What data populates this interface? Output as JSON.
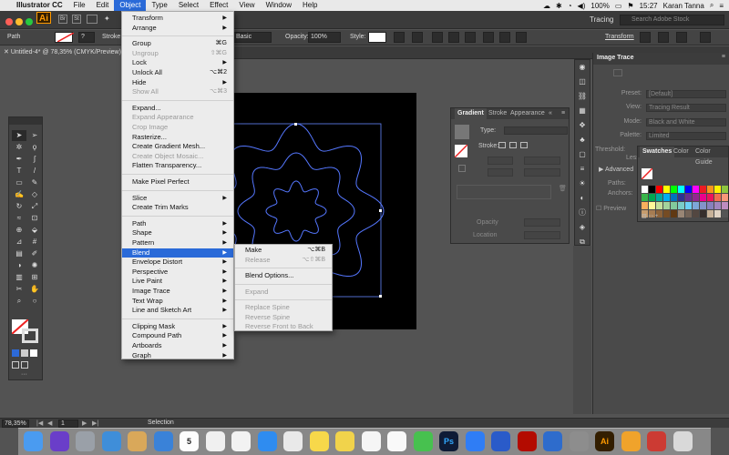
{
  "menubar": {
    "app_name": "Illustrator CC",
    "items": [
      "File",
      "Edit",
      "Object",
      "Type",
      "Select",
      "Effect",
      "View",
      "Window",
      "Help"
    ],
    "active_item": "Object",
    "battery": "100%",
    "time": "15:27",
    "user": "Karan Tanna"
  },
  "appbar": {
    "logo": "Ai",
    "workspace_label": "Tracing",
    "search_placeholder": "Search Adobe Stock"
  },
  "controlbar": {
    "object_type": "Path",
    "stroke_label": "Stroke",
    "brush": "Basic",
    "opacity_label": "Opacity:",
    "opacity_value": "100%",
    "style_label": "Style:",
    "transform_label": "Transform"
  },
  "document": {
    "tab_title": "Untitled-4* @ 78,35% (CMYK/Preview)"
  },
  "object_menu": {
    "items": [
      {
        "label": "Transform",
        "submenu": true
      },
      {
        "label": "Arrange",
        "submenu": true
      },
      {
        "sep": true
      },
      {
        "label": "Group",
        "shortcut": "⌘G"
      },
      {
        "label": "Ungroup",
        "shortcut": "⇧⌘G",
        "disabled": true
      },
      {
        "label": "Lock",
        "submenu": true
      },
      {
        "label": "Unlock All",
        "shortcut": "⌥⌘2"
      },
      {
        "label": "Hide",
        "submenu": true
      },
      {
        "label": "Show All",
        "shortcut": "⌥⌘3",
        "disabled": true
      },
      {
        "sep": true
      },
      {
        "label": "Expand..."
      },
      {
        "label": "Expand Appearance",
        "disabled": true
      },
      {
        "label": "Crop Image",
        "disabled": true
      },
      {
        "label": "Rasterize..."
      },
      {
        "label": "Create Gradient Mesh..."
      },
      {
        "label": "Create Object Mosaic...",
        "disabled": true
      },
      {
        "label": "Flatten Transparency..."
      },
      {
        "sep": true
      },
      {
        "label": "Make Pixel Perfect"
      },
      {
        "sep": true
      },
      {
        "label": "Slice",
        "submenu": true
      },
      {
        "label": "Create Trim Marks"
      },
      {
        "sep": true
      },
      {
        "label": "Path",
        "submenu": true
      },
      {
        "label": "Shape",
        "submenu": true
      },
      {
        "label": "Pattern",
        "submenu": true
      },
      {
        "label": "Blend",
        "submenu": true,
        "highlight": true
      },
      {
        "label": "Envelope Distort",
        "submenu": true
      },
      {
        "label": "Perspective",
        "submenu": true
      },
      {
        "label": "Live Paint",
        "submenu": true
      },
      {
        "label": "Image Trace",
        "submenu": true
      },
      {
        "label": "Text Wrap",
        "submenu": true
      },
      {
        "label": "Line and Sketch Art",
        "submenu": true
      },
      {
        "sep": true
      },
      {
        "label": "Clipping Mask",
        "submenu": true
      },
      {
        "label": "Compound Path",
        "submenu": true
      },
      {
        "label": "Artboards",
        "submenu": true
      },
      {
        "label": "Graph",
        "submenu": true
      }
    ]
  },
  "blend_submenu": {
    "items": [
      {
        "label": "Make",
        "shortcut": "⌥⌘B"
      },
      {
        "label": "Release",
        "shortcut": "⌥⇧⌘B",
        "disabled": true
      },
      {
        "sep": true
      },
      {
        "label": "Blend Options..."
      },
      {
        "sep": true
      },
      {
        "label": "Expand",
        "disabled": true
      },
      {
        "sep": true
      },
      {
        "label": "Replace Spine",
        "disabled": true
      },
      {
        "label": "Reverse Spine",
        "disabled": true
      },
      {
        "label": "Reverse Front to Back",
        "disabled": true
      }
    ]
  },
  "gradient_panel": {
    "tabs": [
      "Gradient",
      "Stroke",
      "Appearance"
    ],
    "type_label": "Type:",
    "stroke_label": "Stroke:",
    "opacity_label": "Opacity",
    "location_label": "Location"
  },
  "image_trace_panel": {
    "title": "Image Trace",
    "rows": [
      {
        "key": "Preset:",
        "value": "[Default]"
      },
      {
        "key": "View:",
        "value": "Tracing Result"
      },
      {
        "key": "Mode:",
        "value": "Black and White"
      },
      {
        "key": "Palette:",
        "value": "Limited"
      },
      {
        "key": "Threshold:",
        "value": ""
      }
    ],
    "less_label": "Less",
    "advanced_label": "Advanced",
    "paths_label": "Paths:",
    "anchors_label": "Anchors:",
    "preview_label": "Preview"
  },
  "swatches_panel": {
    "tabs": [
      "Swatches",
      "Color",
      "Color Guide"
    ],
    "colors": [
      "#ffffff",
      "#000000",
      "#ff0000",
      "#ffff00",
      "#00ff00",
      "#00ffff",
      "#0000ff",
      "#ff00ff",
      "#ed1c24",
      "#f7941d",
      "#fff200",
      "#8dc63f",
      "#39b54a",
      "#00a651",
      "#00a99d",
      "#00aeef",
      "#0072bc",
      "#2e3192",
      "#662d91",
      "#92278f",
      "#ec008c",
      "#ed145b",
      "#f26c4f",
      "#f7977a",
      "#fbaf5d",
      "#fff799",
      "#c4df9b",
      "#a3d39c",
      "#82ca9c",
      "#7accc8",
      "#6dcff6",
      "#7da7d9",
      "#8393ca",
      "#8781bd",
      "#a186be",
      "#bd8cbf",
      "#c69c6d",
      "#a67c52",
      "#8c6239",
      "#754c24",
      "#603913",
      "#998675",
      "#736357",
      "#534741",
      "#362f2d",
      "#c7b299",
      "#e0d3c4",
      "#555555"
    ]
  },
  "status": {
    "zoom": "78,35%",
    "page": "1",
    "mode": "Selection"
  },
  "dock": {
    "icons": [
      "finder-icon",
      "siri-icon",
      "launchpad-icon",
      "preview-icon",
      "notes-pad-icon",
      "finder2-icon",
      "calendar-icon",
      "textedit-icon",
      "reminders-icon",
      "safari-icon",
      "chrome-icon",
      "stickies-icon",
      "notes-icon",
      "photos-icon",
      "itunes-icon",
      "messages-icon",
      "photoshop-icon",
      "appstore-icon",
      "keynote-icon",
      "acrobat-icon",
      "sourcetree-icon",
      "system-prefs-icon",
      "illustrator-icon",
      "sketch-icon",
      "launcher-icon",
      "trash-icon"
    ],
    "calendar_day": "5",
    "ps_label": "Ps",
    "ai_label": "Ai"
  }
}
